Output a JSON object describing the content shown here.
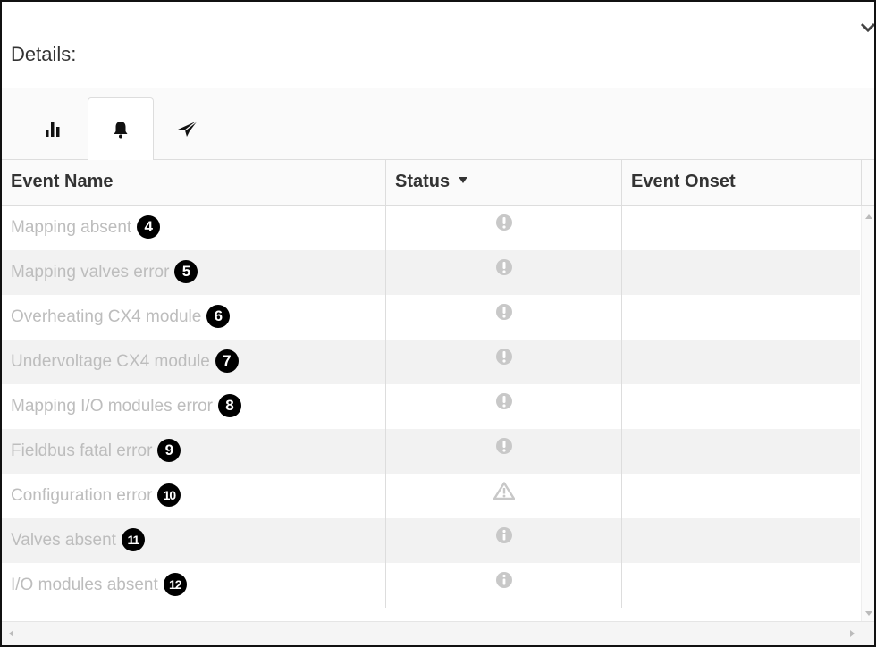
{
  "panel": {
    "title": "Details:",
    "collapse_icon": "chevron-down-icon"
  },
  "tabs": [
    {
      "icon": "bar-chart-icon",
      "active": false
    },
    {
      "icon": "bell-icon",
      "active": true
    },
    {
      "icon": "paper-plane-icon",
      "active": false
    }
  ],
  "table": {
    "columns": [
      "Event Name",
      "Status",
      "Event Onset"
    ],
    "sorted_column": "Status",
    "rows": [
      {
        "name": "Mapping absent",
        "badge": "4",
        "status_icon": "exclamation-circle-icon",
        "onset": ""
      },
      {
        "name": "Mapping valves error",
        "badge": "5",
        "status_icon": "exclamation-circle-icon",
        "onset": ""
      },
      {
        "name": "Overheating CX4 module",
        "badge": "6",
        "status_icon": "exclamation-circle-icon",
        "onset": ""
      },
      {
        "name": "Undervoltage CX4 module",
        "badge": "7",
        "status_icon": "exclamation-circle-icon",
        "onset": ""
      },
      {
        "name": "Mapping I/O modules error",
        "badge": "8",
        "status_icon": "exclamation-circle-icon",
        "onset": ""
      },
      {
        "name": "Fieldbus fatal error",
        "badge": "9",
        "status_icon": "exclamation-circle-icon",
        "onset": ""
      },
      {
        "name": "Configuration error",
        "badge": "10",
        "status_icon": "warning-triangle-icon",
        "onset": ""
      },
      {
        "name": "Valves absent",
        "badge": "11",
        "status_icon": "info-circle-icon",
        "onset": ""
      },
      {
        "name": "I/O modules absent",
        "badge": "12",
        "status_icon": "info-circle-icon",
        "onset": ""
      }
    ]
  },
  "colors": {
    "muted_text": "#bdbdbd",
    "status_icon": "#c8c8c8",
    "badge_bg": "#000000",
    "row_alt": "#f2f2f2"
  }
}
